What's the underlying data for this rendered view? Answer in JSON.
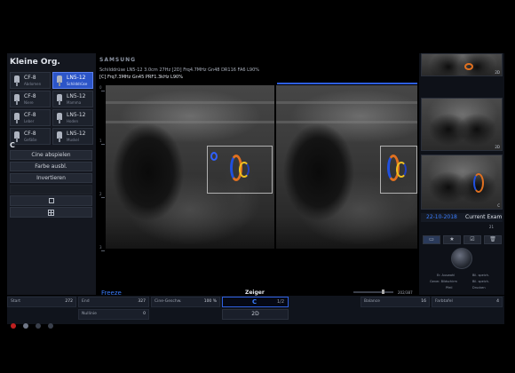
{
  "left_panel": {
    "title": "Kleine Org.",
    "tiles": [
      {
        "probe": "CF-8",
        "preset": "Abdomen",
        "active": false
      },
      {
        "probe": "LN5-12",
        "preset": "Schilddrüse",
        "active": true
      },
      {
        "probe": "CF-8",
        "preset": "Niere",
        "active": false
      },
      {
        "probe": "LN5-12",
        "preset": "Mamma",
        "active": false
      },
      {
        "probe": "CF-8",
        "preset": "Leber",
        "active": false
      },
      {
        "probe": "LN5-12",
        "preset": "Hoden",
        "active": false
      },
      {
        "probe": "CF-8",
        "preset": "Gefäße",
        "active": false
      },
      {
        "probe": "LN5-12",
        "preset": "Muskel",
        "active": false
      }
    ],
    "mode_letter": "C",
    "buttons": [
      "Cine abspielen",
      "Farbe ausbl.",
      "Invertieren"
    ],
    "icon_buttons": [
      "single-view-icon",
      "quad-view-icon"
    ]
  },
  "header": {
    "brand": "SAMSUNG",
    "line1": "Schilddrüse  LN5-12  3.0cm  27Hz    [2D] Frq4.7MHz Gn48 DR116 FA6 L90%",
    "line2": "[C] Frq7.3MHz Gn45 PRF1.3kHz L90%"
  },
  "image": {
    "depth_labels": [
      "0",
      "1",
      "2",
      "3"
    ],
    "status": "Freeze",
    "frame_count": "202/387"
  },
  "right_panel": {
    "thumb_labels": [
      "2D",
      "2D",
      "C"
    ],
    "date": "22-10-2018",
    "exam": "Current Exam",
    "page": "21",
    "toolbar_icons": [
      "layout-icon",
      "star-icon",
      "check-icon",
      "trash-icon"
    ],
    "trackball_labels": {
      "tl1": "Er. Auswahl",
      "tl2": "Gener. Bildschirm",
      "tl3": "Pfeil",
      "tr1": "Bil. speich.",
      "tr2": "Bil. speich.",
      "tr3": "Drucken"
    }
  },
  "bottom_bar": {
    "zeiger": "Zeiger",
    "start_label": "Start",
    "start_value": "272",
    "end_label": "End",
    "end_value": "327",
    "cine_label": "Cine-Geschw.",
    "cine_value": "100 %",
    "center_mode": "C",
    "center_frac": "1/2",
    "second_mode": "2D",
    "nullinie_label": "Nullinie",
    "nullinie_value": "0",
    "balance_label": "Balance",
    "balance_value": "16",
    "farbtafel_label": "Farbtafel",
    "farbtafel_value": "4"
  },
  "colors": {
    "accent": "#2e5fe0",
    "active_tile": "#2c55c8",
    "freeze_text": "#3a7dff"
  }
}
